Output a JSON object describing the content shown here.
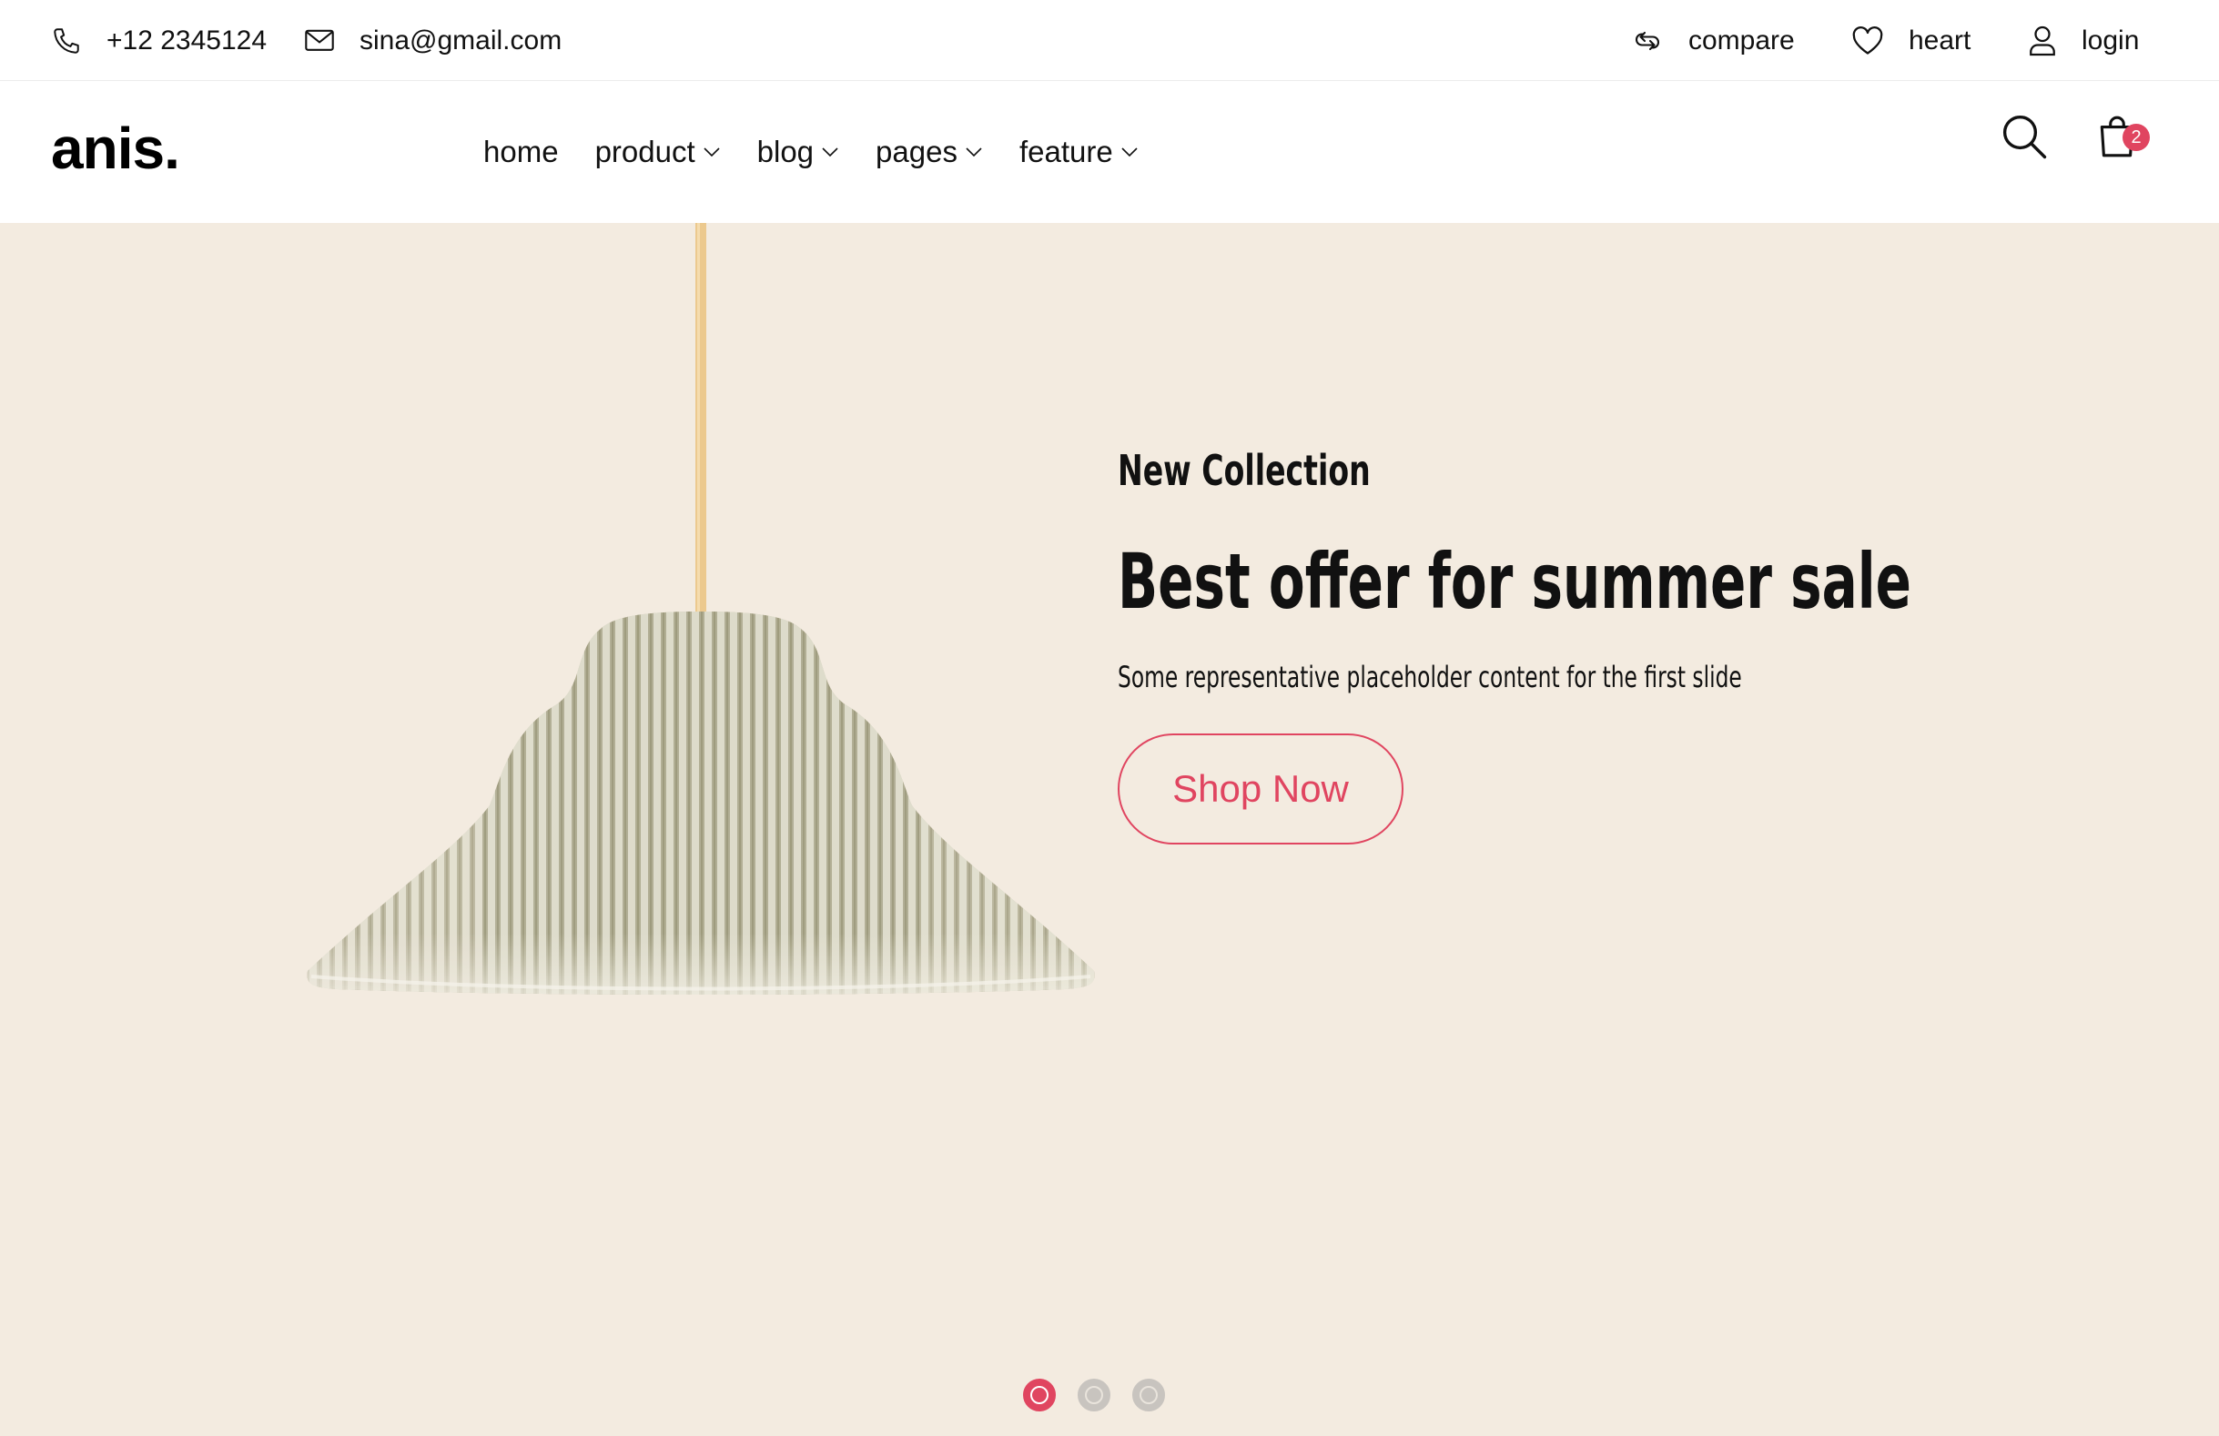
{
  "topbar": {
    "phone": "+12 2345124",
    "email": "sina@gmail.com",
    "compare_label": "compare",
    "heart_label": "heart",
    "login_label": "login"
  },
  "header": {
    "logo": "anis.",
    "nav": [
      {
        "label": "home",
        "has_dropdown": false
      },
      {
        "label": "product",
        "has_dropdown": true
      },
      {
        "label": "blog",
        "has_dropdown": true
      },
      {
        "label": "pages",
        "has_dropdown": true
      },
      {
        "label": "feature",
        "has_dropdown": true
      }
    ],
    "cart_count": "2"
  },
  "hero": {
    "kicker": "New Collection",
    "headline": "Best offer for summer sale",
    "subtext": "Some representative placeholder content for the first slide",
    "cta_label": "Shop Now",
    "slide_indicators": {
      "total": 3,
      "active_index": 0
    }
  },
  "colors": {
    "accent": "#e04560",
    "hero_background": "#f3ebe0",
    "lamp_shade": "#c9c6b0",
    "lamp_cord": "#ecc98e"
  },
  "icons": [
    "phone-icon",
    "mail-icon",
    "compare-icon",
    "heart-icon",
    "user-icon",
    "chevron-down-icon",
    "search-icon",
    "shopping-bag-icon",
    "pendant-lamp-image"
  ]
}
